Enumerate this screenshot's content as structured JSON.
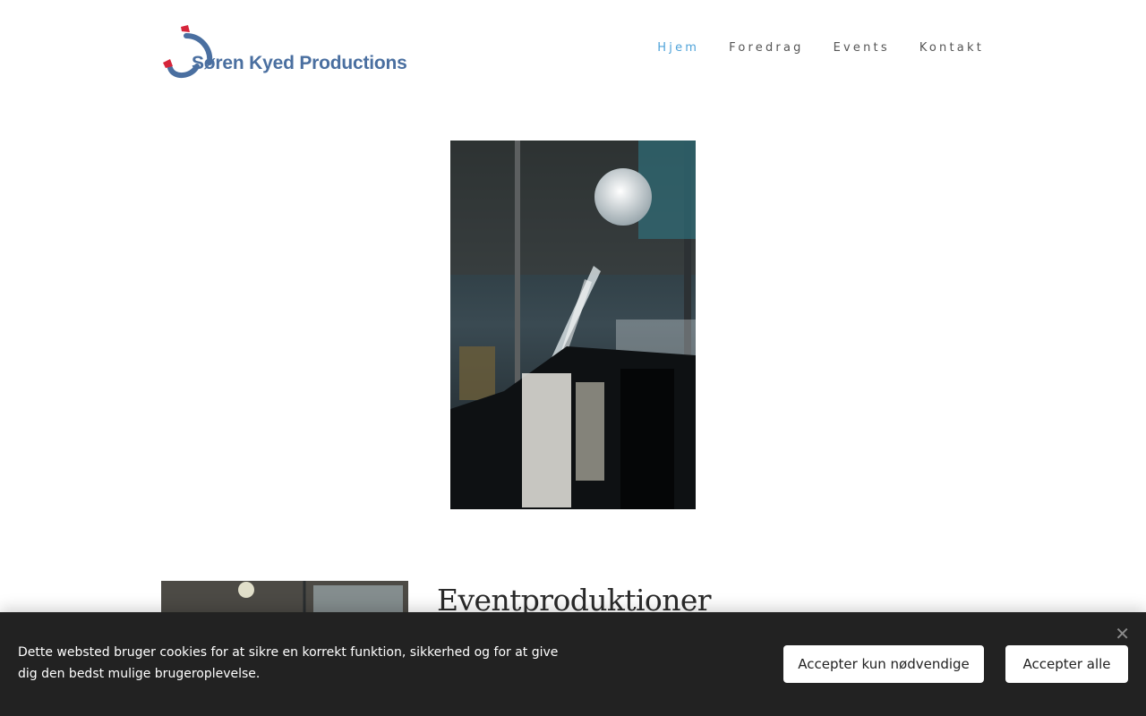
{
  "header": {
    "logo_text": "Søren Kyed Productions"
  },
  "nav": {
    "items": [
      {
        "label": "Hjem",
        "active": true
      },
      {
        "label": "Foredrag",
        "active": false
      },
      {
        "label": "Events",
        "active": false
      },
      {
        "label": "Kontakt",
        "active": false
      }
    ]
  },
  "section": {
    "title": "Eventproduktioner"
  },
  "cookie_banner": {
    "text": "Dette websted bruger cookies for at sikre en korrekt funktion, sikkerhed og for at give dig den bedst mulige brugeroplevelse.",
    "close_icon": "close-icon",
    "accept_necessary_label": "Accepter kun nødvendige",
    "accept_all_label": "Accepter alle"
  },
  "colors": {
    "nav_active": "#4fa3d9",
    "logo_blue": "#4a6fa0",
    "logo_red": "#d6243a",
    "banner_bg": "#222222"
  }
}
